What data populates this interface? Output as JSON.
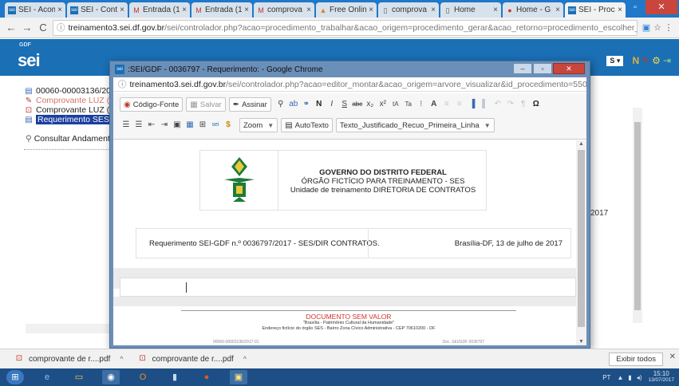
{
  "browser": {
    "tabs": [
      {
        "label": "SEI - Acom",
        "icon": "sei-favicon"
      },
      {
        "label": "SEI - Contr",
        "icon": "sei-favicon"
      },
      {
        "label": "Entrada (1",
        "icon": "gmail-icon"
      },
      {
        "label": "Entrada (1",
        "icon": "gmail-icon"
      },
      {
        "label": "comprova",
        "icon": "gmail-icon"
      },
      {
        "label": "Free Onlin",
        "icon": "pdf-tool-icon"
      },
      {
        "label": "comprova",
        "icon": "document-icon"
      },
      {
        "label": "Home",
        "icon": "document-icon"
      },
      {
        "label": "Home - G",
        "icon": "opera-icon"
      },
      {
        "label": "SEI - Proc",
        "icon": "sei-favicon"
      }
    ],
    "address": {
      "host": "treinamento3.sei.df.gov.br",
      "path": "/sei/controlador.php?acao=procedimento_trabalhar&acao_origem=procedimento_gerar&acao_retorno=procedimento_escolher_tipo&id_procedimento=55054&"
    }
  },
  "sei": {
    "gdf_label": "GDF",
    "logo": "sei",
    "unit_select": "S",
    "tree": {
      "process": "00060-00003136/2017-",
      "items": [
        {
          "label": "Comprovante LUZ (0",
          "style": "red"
        },
        {
          "label": "Comprovante LUZ (0",
          "style": "normal"
        },
        {
          "label": "Requerimento SES/D",
          "style": "selected"
        }
      ]
    },
    "consultar": "Consultar Andamento",
    "year_fragment": "2017"
  },
  "popup": {
    "title": ":SEI/GDF - 0036797 - Requerimento: - Google Chrome",
    "url_host": "treinamento3.sei.df.gov.br",
    "url_path": "/sei/controlador.php?acao=editor_montar&acao_origem=arvore_visualizar&id_procedimento=55054&id_documento=55C",
    "toolbar": {
      "codigo_fonte": "Código-Fonte",
      "salvar": "Salvar",
      "assinar": "Assinar",
      "zoom": "Zoom",
      "autotexto": "AutoTexto",
      "style_select": "Texto_Justificado_Recuo_Primeira_Linha"
    },
    "document": {
      "header_line1": "GOVERNO DO DISTRITO FEDERAL",
      "header_line2": "ÓRGÃO FICTÍCIO PARA TREINAMENTO - SES",
      "header_line3": "Unidade de treinamento DIRETORIA DE CONTRATOS",
      "reference": "Requerimento SEI-GDF n.º 0036797/2017 - SES/DIR CONTRATOS.",
      "place_date": "Brasília-DF, 13 de julho de 2017",
      "stamp": "DOCUMENTO SEM VALOR",
      "footer_line1": "\"Brasília - Patrimônio Cultural da Humanidade\"",
      "footer_line2": "Endereço fictício do órgão SES - Bairro Zona Cívico Administrativa - CEP 70610200 - DF",
      "footer_left": "00060-00003136/2017-01",
      "footer_right": "Doc. SEI/GDF 0036797"
    }
  },
  "downloads": {
    "items": [
      {
        "label": "comprovante de r....pdf"
      },
      {
        "label": "comprovante de r....pdf"
      }
    ],
    "show_all": "Exibir todos"
  },
  "taskbar": {
    "lang": "PT",
    "time": "15:10",
    "date": "13/07/2017"
  },
  "colors": {
    "tabstrip": "#1f78c8",
    "sei_header": "#1a6fb5",
    "selected_node": "#1b3fa0",
    "stamp_red": "#d0342c",
    "taskbar": "#1d4f86"
  }
}
